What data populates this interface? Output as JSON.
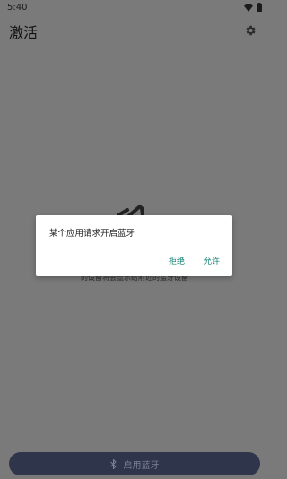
{
  "status_bar": {
    "time": "5:40",
    "icons": [
      "wifi-icon",
      "battery-icon"
    ]
  },
  "app_bar": {
    "title": "激活",
    "settings_icon": "gear-icon"
  },
  "background": {
    "caption": "的设备将会显示给附近的蓝牙设备"
  },
  "dialog": {
    "message": "某个应用请求开启蓝牙",
    "deny_label": "拒绝",
    "allow_label": "允许",
    "accent_color": "#0f7f73"
  },
  "bottom_button": {
    "label": "启用蓝牙",
    "icon": "bluetooth-icon"
  },
  "colors": {
    "scrim": "#7a7a7a",
    "bottom_button_bg": "#2f354a"
  }
}
